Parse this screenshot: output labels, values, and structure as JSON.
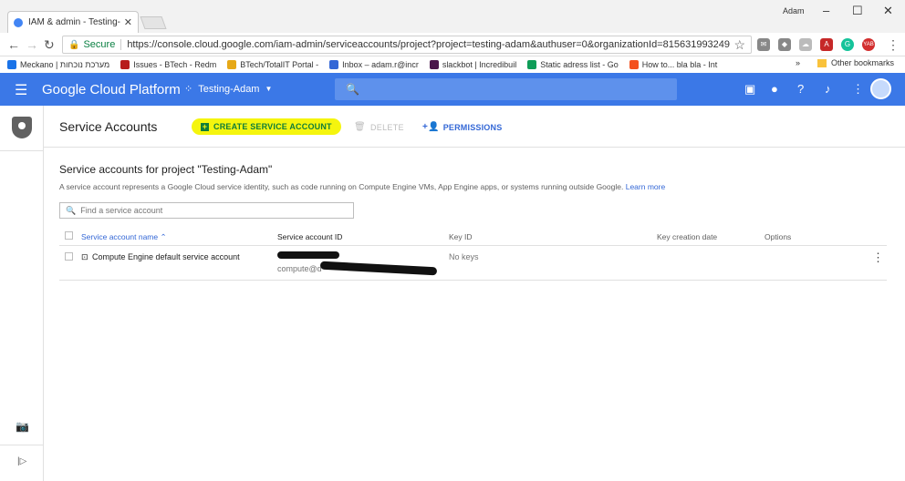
{
  "browser": {
    "tab_title": "IAM & admin - Testing-A",
    "window_user": "Adam",
    "secure_label": "Secure",
    "url": "https://console.cloud.google.com/iam-admin/serviceaccounts/project?project=testing-adam&authuser=0&organizationId=815631993249",
    "extensions": [
      "YAB"
    ]
  },
  "bookmarks": {
    "items": [
      {
        "label": "Meckano | מערכת נוכחות",
        "color": "#1a73e8"
      },
      {
        "label": "Issues - BTech - Redm",
        "color": "#b71c1c"
      },
      {
        "label": "BTech/TotalIT Portal -",
        "color": "#e6a817"
      },
      {
        "label": "Inbox – adam.r@incr",
        "color": "#3367d6"
      },
      {
        "label": "slackbot | Incredibuil",
        "color": "#4a154b"
      },
      {
        "label": "Static adress list - Go",
        "color": "#0f9d58"
      },
      {
        "label": "How to... bla bla - Int",
        "color": "#f4511e"
      }
    ],
    "more": "»",
    "other": "Other bookmarks"
  },
  "header": {
    "logo": "Google Cloud Platform",
    "project": "Testing-Adam"
  },
  "toolbar": {
    "title": "Service Accounts",
    "create_label": "CREATE SERVICE ACCOUNT",
    "delete_label": "DELETE",
    "permissions_label": "PERMISSIONS"
  },
  "main": {
    "section_title": "Service accounts for project \"Testing-Adam\"",
    "description": "A service account represents a Google Cloud service identity, such as code running on Compute Engine VMs, App Engine apps, or systems running outside Google.",
    "learn_more": "Learn more",
    "search_placeholder": "Find a service account"
  },
  "table": {
    "columns": [
      "Service account name",
      "Service account ID",
      "Key ID",
      "Key creation date",
      "Options"
    ],
    "rows": [
      {
        "name": "Compute Engine default service account",
        "id_partial": "compute@d",
        "key_id": "No keys"
      }
    ]
  },
  "colors": {
    "header_blue": "#3b78e7",
    "highlight_yellow": "#f5f50e",
    "create_green": "#0f7d3a",
    "link_blue": "#3367d6"
  }
}
